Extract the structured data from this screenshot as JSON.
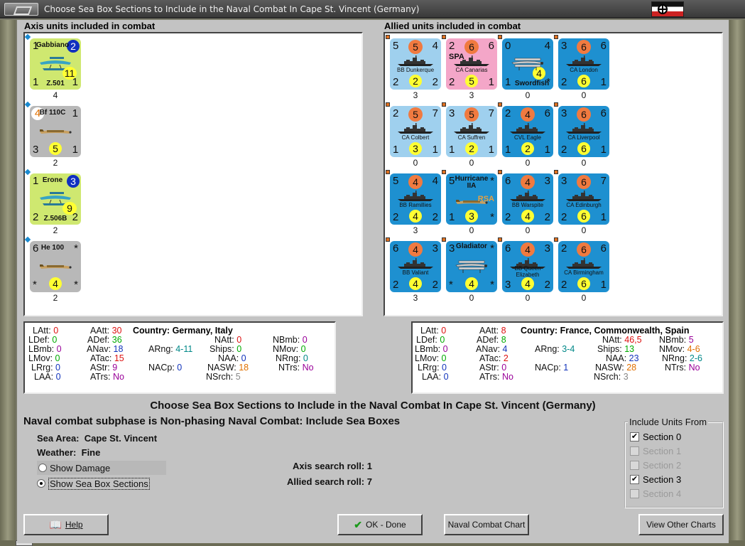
{
  "window": {
    "title": "Choose Sea Box Sections to Include in the Naval Combat In Cape St. Vincent (Germany)"
  },
  "axis": {
    "title": "Axis units included in combat",
    "units": [
      {
        "name": "Gabbiano",
        "sub": "Z.501",
        "tl": "1",
        "tr": "2",
        "bl": "1",
        "br": "1",
        "center": "11",
        "count": "4",
        "color": "#cfe870",
        "type": "seaplane"
      },
      {
        "name": "Bf 110C",
        "sub": "",
        "tl": "4",
        "tr": "1",
        "bl": "3",
        "br": "1",
        "center": "5",
        "count": "2",
        "color": "#b8b8b8",
        "type": "fighter"
      },
      {
        "name": "Erone",
        "sub": "Z.506B",
        "tl": "1",
        "tr": "3",
        "bl": "2",
        "br": "2",
        "center": "9",
        "count": "2",
        "color": "#cfe870",
        "type": "seaplane"
      },
      {
        "name": "He 100",
        "sub": "",
        "tl": "6",
        "tr": "*",
        "bl": "*",
        "br": "*",
        "center": "4",
        "count": "2",
        "color": "#b8b8b8",
        "type": "fighter"
      }
    ]
  },
  "allied": {
    "title": "Allied units included in combat",
    "units": [
      {
        "name": "BB Dunkerque",
        "tl": "5",
        "tc": "5",
        "tr": "4",
        "bl": "2",
        "bc": "2",
        "br": "2",
        "count": "3",
        "color": "#9fd0ee",
        "type": "ship"
      },
      {
        "name": "CA Canarias",
        "tag": "SPA",
        "tl": "2",
        "tc": "6",
        "tr": "6",
        "bl": "2",
        "bc": "5",
        "br": "1",
        "count": "3",
        "color": "#f4a6c8",
        "type": "ship"
      },
      {
        "name": "Swordfish",
        "tl": "0",
        "tc": "",
        "tr": "4",
        "bl": "1",
        "bc": "4",
        "br": "*",
        "count": "0",
        "color": "#1e90d0",
        "type": "biplane"
      },
      {
        "name": "CA London",
        "tl": "3",
        "tc": "6",
        "tr": "6",
        "bl": "2",
        "bc": "6",
        "br": "1",
        "count": "0",
        "color": "#1e90d0",
        "type": "ship"
      },
      {
        "name": "CA Colbert",
        "tl": "2",
        "tc": "5",
        "tr": "7",
        "bl": "1",
        "bc": "3",
        "br": "1",
        "count": "0",
        "color": "#9fd0ee",
        "type": "ship"
      },
      {
        "name": "CA Suffren",
        "tl": "3",
        "tc": "5",
        "tr": "7",
        "bl": "1",
        "bc": "2",
        "br": "1",
        "count": "0",
        "color": "#9fd0ee",
        "type": "ship"
      },
      {
        "name": "CVL Eagle",
        "tl": "2",
        "tc": "4",
        "tr": "6",
        "bl": "1",
        "bc": "2",
        "br": "1",
        "count": "0",
        "color": "#1e90d0",
        "type": "ship"
      },
      {
        "name": "CA Liverpool",
        "tl": "3",
        "tc": "6",
        "tr": "6",
        "bl": "2",
        "bc": "6",
        "br": "1",
        "count": "0",
        "color": "#1e90d0",
        "type": "ship"
      },
      {
        "name": "BB Ramillies",
        "tl": "5",
        "tc": "4",
        "tr": "4",
        "bl": "2",
        "bc": "4",
        "br": "2",
        "count": "3",
        "color": "#1e90d0",
        "type": "ship"
      },
      {
        "name": "Hurricane IIA",
        "tag": "RSA",
        "tl": "5",
        "tc": "",
        "tr": "*",
        "bl": "1",
        "bc": "3",
        "br": "*",
        "count": "0",
        "color": "#1e90d0",
        "type": "fighter"
      },
      {
        "name": "BB Warspite",
        "tl": "6",
        "tc": "4",
        "tr": "3",
        "bl": "2",
        "bc": "4",
        "br": "2",
        "count": "0",
        "color": "#1e90d0",
        "type": "ship"
      },
      {
        "name": "CA Edinburgh",
        "tl": "3",
        "tc": "6",
        "tr": "7",
        "bl": "2",
        "bc": "6",
        "br": "1",
        "count": "0",
        "color": "#1e90d0",
        "type": "ship"
      },
      {
        "name": "BB Valiant",
        "tl": "6",
        "tc": "4",
        "tr": "3",
        "bl": "2",
        "bc": "4",
        "br": "2",
        "count": "3",
        "color": "#1e90d0",
        "type": "ship"
      },
      {
        "name": "Gladiator",
        "tl": "3",
        "tc": "",
        "tr": "*",
        "bl": "*",
        "bc": "4",
        "br": "*",
        "count": "0",
        "color": "#1e90d0",
        "type": "biplane"
      },
      {
        "name": "BB Queen Elizabeth",
        "tl": "6",
        "tc": "4",
        "tr": "3",
        "bl": "3",
        "bc": "4",
        "br": "2",
        "count": "0",
        "color": "#1e90d0",
        "type": "ship"
      },
      {
        "name": "CA Birmingham",
        "tl": "2",
        "tc": "6",
        "tr": "6",
        "bl": "2",
        "bc": "6",
        "br": "1",
        "count": "0",
        "color": "#1e90d0",
        "type": "ship"
      }
    ]
  },
  "axis_stats": {
    "country_label": "Country:",
    "country": "Germany, Italy",
    "latt": "0",
    "ldef": "0",
    "lbmb": "0",
    "lmov": "0",
    "lrg": "0",
    "laa": "0",
    "aatt": "30",
    "adef": "36",
    "anav": "18",
    "atac": "15",
    "astr": "9",
    "atrs": "No",
    "arng": "4-11",
    "nacp": "0",
    "natt": "0",
    "ships": "0",
    "naa": "0",
    "nasw": "18",
    "nsrch": "5",
    "nbmb": "0",
    "nmov": "0",
    "nrng": "0",
    "ntrs": "No"
  },
  "allied_stats": {
    "country_label": "Country:",
    "country": "France, Commonwealth, Spain",
    "latt": "0",
    "ldef": "0",
    "lbmb": "0",
    "lmov": "0",
    "lrg": "0",
    "laa": "0",
    "aatt": "8",
    "adef": "8",
    "anav": "4",
    "atac": "2",
    "astr": "0",
    "atrs": "No",
    "arng": "3-4",
    "nacp": "1",
    "natt": "46,5",
    "ships": "13",
    "naa": "23",
    "nasw": "28",
    "nsrch": "3",
    "nbmb": "5",
    "nmov": "4-6",
    "nrng": "2-6",
    "ntrs": "No"
  },
  "headline": "Choose Sea Box Sections to Include in the Naval Combat In Cape St. Vincent (Germany)",
  "subphase": "Naval combat subphase is Non-phasing Naval Combat: Include Sea Boxes",
  "sea_area_label": "Sea Area:",
  "sea_area": "Cape St. Vincent",
  "weather_label": "Weather:",
  "weather": "Fine",
  "options": {
    "show_damage": "Show Damage",
    "show_sections": "Show Sea Box Sections"
  },
  "search": {
    "axis_label": "Axis search roll:",
    "axis_value": "1",
    "allied_label": "Allied search roll:",
    "allied_value": "7"
  },
  "include": {
    "title": "Include Units From",
    "sections": [
      {
        "label": "Section 0",
        "checked": true,
        "enabled": true
      },
      {
        "label": "Section 1",
        "checked": false,
        "enabled": false
      },
      {
        "label": "Section 2",
        "checked": false,
        "enabled": false
      },
      {
        "label": "Section 3",
        "checked": true,
        "enabled": true
      },
      {
        "label": "Section 4",
        "checked": false,
        "enabled": false
      }
    ]
  },
  "buttons": {
    "help": "Help",
    "ok": "OK - Done",
    "chart": "Naval Combat Chart",
    "other": "View Other Charts"
  }
}
